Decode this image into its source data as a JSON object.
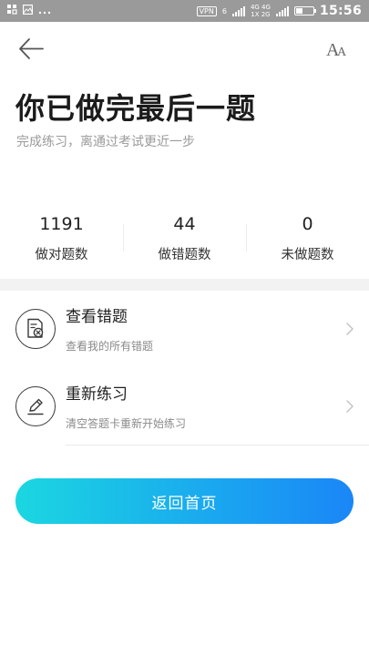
{
  "status_bar": {
    "left_icons": [
      "grid-icon",
      "image-icon",
      "more-dots"
    ],
    "vpn": "VPN",
    "network": {
      "top": "4G 4G",
      "bottom": "1X 2G"
    },
    "sim_label": "6",
    "time": "15:56"
  },
  "nav": {
    "back_icon": "arrow-left-icon",
    "font_icon": "font-size-icon",
    "font_glyph": "AA"
  },
  "header": {
    "title": "你已做完最后一题",
    "subtitle": "完成练习，离通过考试更近一步"
  },
  "stats": [
    {
      "value": "1191",
      "label": "做对题数"
    },
    {
      "value": "44",
      "label": "做错题数"
    },
    {
      "value": "0",
      "label": "未做题数"
    }
  ],
  "actions": [
    {
      "title": "查看错题",
      "desc": "查看我的所有错题",
      "icon": "wrong-list-icon"
    },
    {
      "title": "重新练习",
      "desc": "清空答题卡重新开始练习",
      "icon": "pencil-icon"
    }
  ],
  "home_button": {
    "label": "返回首页"
  },
  "colors": {
    "status_bar": "#9a9a9a",
    "gradient_start": "#1bd7e0",
    "gradient_end": "#1a86f7",
    "band": "#f2f2f2"
  }
}
